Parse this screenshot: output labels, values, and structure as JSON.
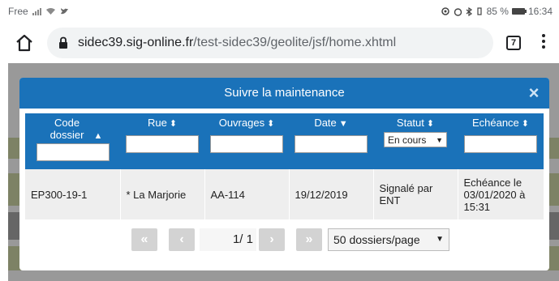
{
  "statusbar": {
    "carrier": "Free",
    "battery_text": "85 %",
    "time": "16:34"
  },
  "browser": {
    "url_host": "sidec39.sig-online.fr",
    "url_path": "/test-sidec39/geolite/jsf/home.xhtml",
    "tab_count": "7"
  },
  "dialog": {
    "title": "Suivre la maintenance",
    "close_icon": "×"
  },
  "table": {
    "columns": [
      {
        "label": "Code dossier",
        "sort_icon": "updown"
      },
      {
        "label": "Rue",
        "sort_icon": "updown"
      },
      {
        "label": "Ouvrages",
        "sort_icon": "updown"
      },
      {
        "label": "Date",
        "sort_icon": "down"
      },
      {
        "label": "Statut",
        "sort_icon": "updown",
        "filter_value": "En cours"
      },
      {
        "label": "Echéance",
        "sort_icon": "updown"
      }
    ],
    "rows": [
      {
        "code": "EP300-19-1",
        "rue": "* La Marjorie",
        "ouvrages": "AA-114",
        "date": "19/12/2019",
        "statut": "Signalé par ENT",
        "echeance": "Echéance le 03/01/2020 à 15:31"
      }
    ]
  },
  "pager": {
    "first": "«",
    "prev": "‹",
    "page_info": "1/ 1",
    "next": "›",
    "last": "»",
    "page_size": "50 dossiers/page"
  },
  "colors": {
    "dialog_header": "#1a72b9",
    "row_bg": "#eeeeee",
    "pager_button": "#d3d3d3"
  }
}
